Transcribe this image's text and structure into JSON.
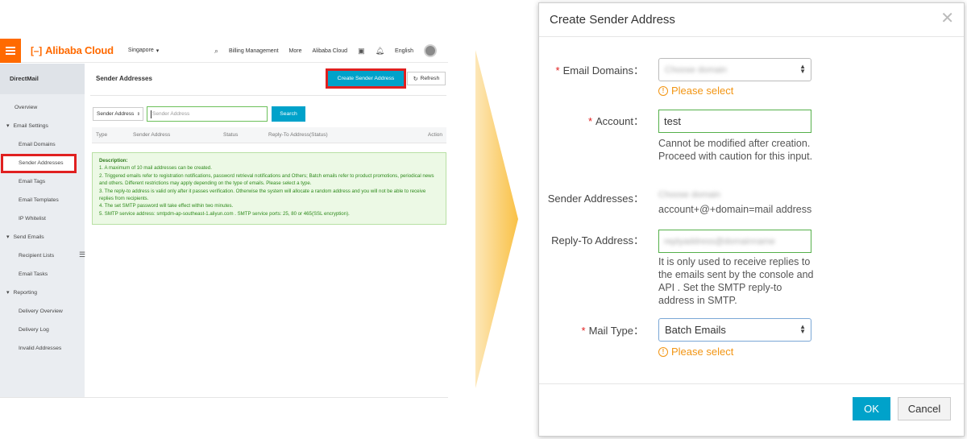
{
  "console": {
    "brand": "Alibaba Cloud",
    "region": "Singapore",
    "topnav": {
      "billing": "Billing Management",
      "more": "More",
      "alibaba_cloud": "Alibaba Cloud",
      "language": "English"
    },
    "sidebar": {
      "title": "DirectMail",
      "items": [
        {
          "label": "Overview",
          "type": "item"
        },
        {
          "label": "Email Settings",
          "type": "group"
        },
        {
          "label": "Email Domains",
          "type": "sub"
        },
        {
          "label": "Sender Addresses",
          "type": "active"
        },
        {
          "label": "Email Tags",
          "type": "sub"
        },
        {
          "label": "Email Templates",
          "type": "sub"
        },
        {
          "label": "IP Whitelist",
          "type": "sub"
        },
        {
          "label": "Send Emails",
          "type": "group"
        },
        {
          "label": "Recipient Lists",
          "type": "sub"
        },
        {
          "label": "Email Tasks",
          "type": "sub"
        },
        {
          "label": "Reporting",
          "type": "group"
        },
        {
          "label": "Delivery Overview",
          "type": "sub"
        },
        {
          "label": "Delivery Log",
          "type": "sub"
        },
        {
          "label": "Invalid Addresses",
          "type": "sub"
        }
      ]
    },
    "main": {
      "title": "Sender Addresses",
      "create_button": "Create Sender Address",
      "refresh_button": "Refresh",
      "filter_select": "Sender Address",
      "filter_placeholder": "Sender Address",
      "search_button": "Search",
      "columns": {
        "type": "Type",
        "sender": "Sender Address",
        "status": "Status",
        "reply_to": "Reply-To Address(Status)",
        "action": "Action"
      },
      "description_title": "Description:",
      "description_lines": [
        "1. A maximum of 10 mail addresses can be created.",
        "2. Triggered emails refer to registration notifications, password retrieval notifications and Others; Batch emails refer to product promotions, periodical news and others. Different restrictions may apply depending on the type of emails. Please select a type.",
        "3. The reply-to address is valid only after it passes verification. Otherwise the system will allocate a random address and you will not be able to receive replies from recipients.",
        "4. The set SMTP password will take effect within two minutes.",
        "5. SMTP service address: smtpdm-ap-southeast-1.aliyun.com . SMTP service ports: 25, 80 or 465(SSL encryption)."
      ]
    }
  },
  "dialog": {
    "title": "Create Sender Address",
    "email_domains_label": "Email Domains：",
    "email_domains_value": "Choose domain",
    "please_select": "Please select",
    "account_label": "Account：",
    "account_value": "test",
    "account_help": "Cannot be modified after creation. Proceed with caution for this input.",
    "sender_label": "Sender Addresses：",
    "sender_blurred": "Choose domain",
    "sender_format": "account+@+domain=mail address",
    "reply_label": "Reply-To Address：",
    "reply_value": "replyaddress@domainname",
    "reply_help": "It is only used to receive replies to the emails sent by the console and API . Set the SMTP reply-to address in SMTP.",
    "mail_type_label": "Mail Type：",
    "mail_type_value": "Batch Emails",
    "ok_button": "OK",
    "cancel_button": "Cancel"
  },
  "colors": {
    "brand": "#ff6a00",
    "primary": "#00a2ca",
    "highlight": "#e02020",
    "warning": "#f29513",
    "arrow": "#f9c146"
  }
}
